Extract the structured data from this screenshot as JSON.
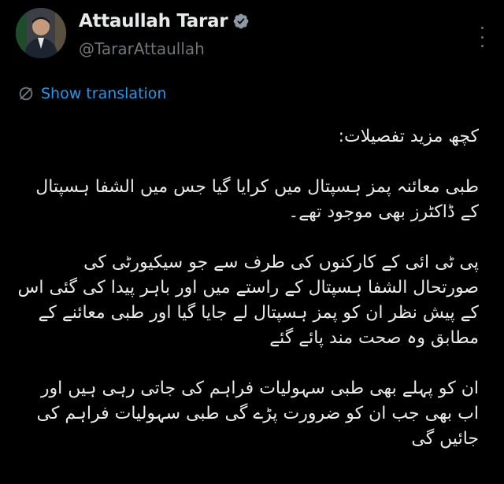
{
  "author": {
    "display_name": "Attaullah Tarar",
    "handle": "@TararAttaullah",
    "verified": true
  },
  "translate": {
    "label": "Show translation",
    "icon": "translate-globe-icon"
  },
  "more_icon": "more-vertical-icon",
  "colors": {
    "background": "#000000",
    "text": "#e7e9ea",
    "secondary": "#71767b",
    "link": "#1d9bf0",
    "verified": "#8b98a5"
  },
  "tweet": {
    "paragraphs": [
      "کچھ مزید تفصیلات:",
      "طبی معائنہ پمز ہسپتال میں کرایا گیا جس میں الشفا ہسپتال کے ڈاکٹرز بھی موجود تھے۔",
      "پی ٹی ائی کے کارکنوں کی طرف سے جو سیکیورٹی کی صورتحال الشفا ہسپتال کے راستے میں اور باہر پیدا کی گئی اس کے پیش نظر ان کو پمز ہسپتال لے جایا گیا اور طبی معائنے کے مطابق وہ صحت مند پائے گئے",
      "ان کو پہلے بھی طبی سہولیات فراہم کی جاتی رہی ہیں اور اب بھی جب ان کو ضرورت پڑے گی طبی سہولیات فراہم کی جائیں گی"
    ]
  }
}
